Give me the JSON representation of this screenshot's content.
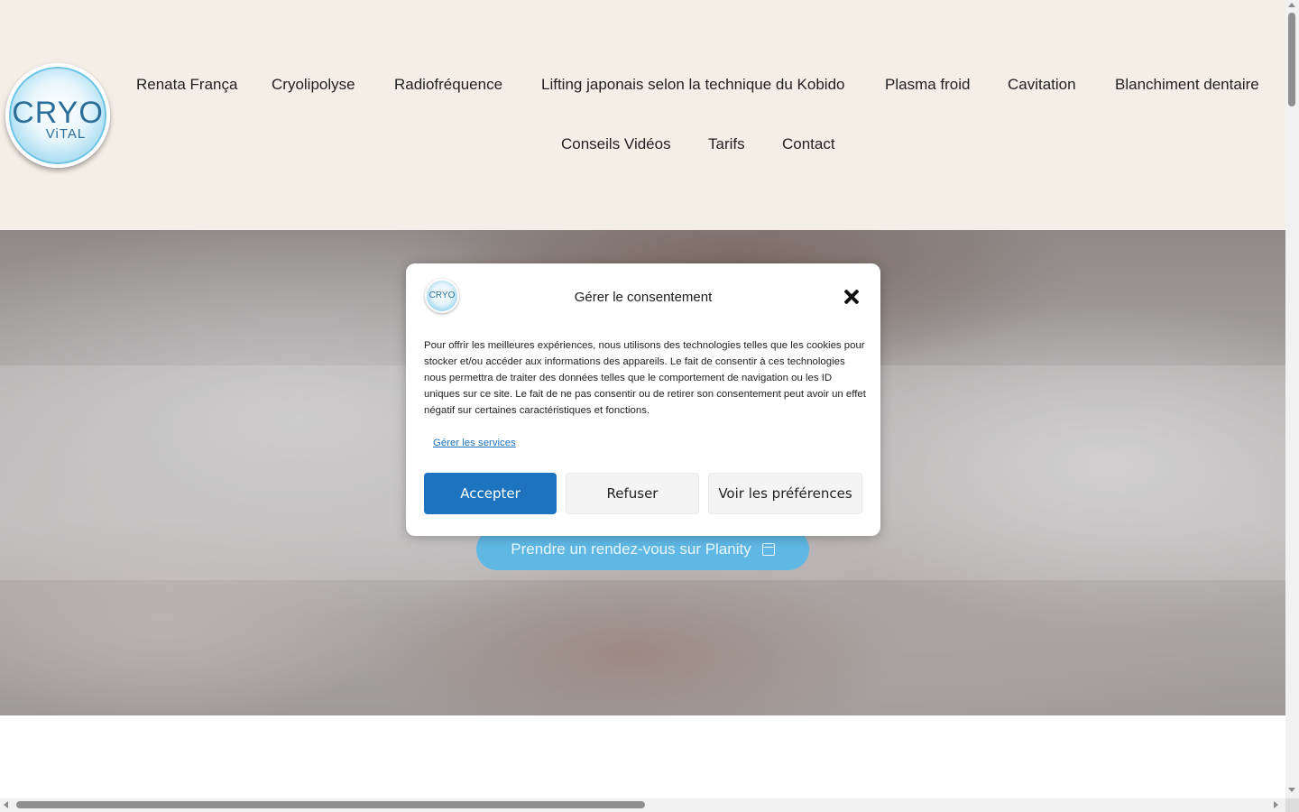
{
  "header": {
    "logo": {
      "main": "CRYO",
      "sub": "ViTAL"
    },
    "nav": [
      "Renata França",
      "Cryolipolyse",
      "Radiofréquence",
      "Lifting japonais selon la technique du Kobido",
      "Plasma froid",
      "Cavitation",
      "Blanchiment dentaire",
      "Conseils Vidéos",
      "Tarifs",
      "Contact"
    ]
  },
  "hero": {
    "cta_label": "Prendre un rendez-vous sur Planity",
    "cta_icon": "calendar-icon"
  },
  "consent": {
    "logo": "CRYO",
    "title": "Gérer le consentement",
    "close_icon": "close-icon",
    "body": "Pour offrir les meilleures expériences, nous utilisons des technologies telles que les cookies pour stocker et/ou accéder aux informations des appareils. Le fait de consentir à ces technologies nous permettra de traiter des données telles que le comportement de navigation ou les ID uniques sur ce site. Le fait de ne pas consentir ou de retirer son consentement peut avoir un effet négatif sur certaines caractéristiques et fonctions.",
    "manage_link": "Gérer les services",
    "buttons": {
      "accept": "Accepter",
      "refuse": "Refuser",
      "preferences": "Voir les préférences"
    }
  },
  "colors": {
    "header_bg": "#f4efe6",
    "accent": "#1e73be",
    "cta_bg": "#5fb8e3"
  }
}
